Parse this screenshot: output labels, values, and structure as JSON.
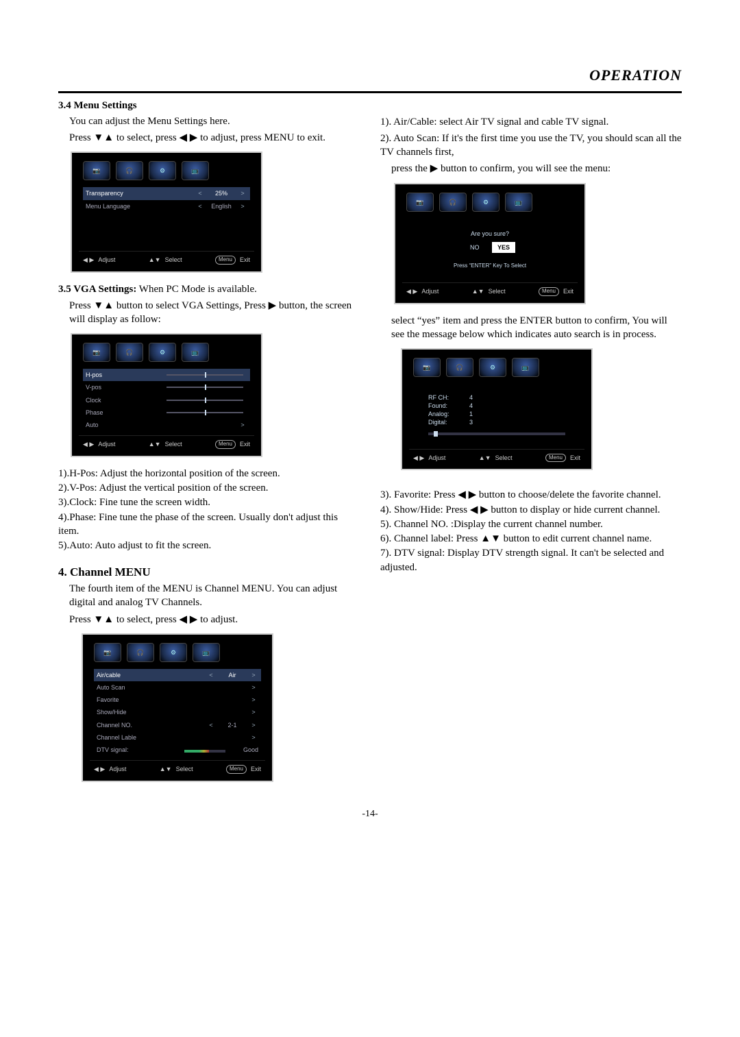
{
  "header": {
    "title": "OPERATION"
  },
  "footer": {
    "page": "-14-"
  },
  "left": {
    "s34": {
      "heading": "3.4  Menu Settings",
      "p1": "You can adjust the Menu Settings here.",
      "p2": "Press ▼▲ to select, press ◀ ▶ to adjust, press MENU to exit."
    },
    "s35": {
      "heading": "3.5  VGA Settings:",
      "heading_tail": " When PC Mode is  available.",
      "p1": "Press ▼▲ button to select VGA Settings, Press ▶ button, the screen will display as follow:",
      "i1": "1).H-Pos: Adjust the horizontal position of the screen.",
      "i2": "2).V-Pos: Adjust the vertical position of the screen.",
      "i3": "3).Clock: Fine tune the screen width.",
      "i4": "4).Phase: Fine tune the phase of the screen. Usually don't adjust this item.",
      "i5": "5).Auto: Auto adjust to fit the screen."
    },
    "s4": {
      "heading": "4. Channel MENU",
      "p1": "The fourth item of the MENU is Channel MENU. You can adjust digital and analog TV Channels.",
      "p2": "Press ▼▲   to select, press ◀ ▶   to adjust."
    }
  },
  "right": {
    "r1": "1). Air/Cable: select Air TV signal and cable TV signal.",
    "r2a": "2). Auto Scan: If it's the first time you use the TV, you should scan all the TV channels first,",
    "r2b": "press the ▶ button  to confirm, you will see the menu:",
    "r2cont": "select “yes” item and press the  ENTER  button  to confirm, You will see the message below which indicates auto search is in process.",
    "r3": "3). Favorite: Press ◀ ▶ button to choose/delete the favorite channel.",
    "r4": "4). Show/Hide: Press ◀ ▶ button to display or hide current channel.",
    "r5": "5). Channel NO. :Display the current channel number.",
    "r6": "6). Channel label: Press ▲▼ button to edit current channel name.",
    "r7": "7). DTV signal: Display DTV strength signal. It can't be selected and adjusted."
  },
  "osd_common": {
    "adjust": "Adjust",
    "select": "Select",
    "menu": "Menu",
    "exit": "Exit"
  },
  "osd_menu": {
    "row1_label": "Transparency",
    "row1_val": "25%",
    "row2_label": "Menu Language",
    "row2_val": "English"
  },
  "osd_vga": {
    "r1": "H-pos",
    "r2": "V-pos",
    "r3": "Clock",
    "r4": "Phase",
    "r5": "Auto"
  },
  "osd_channel": {
    "r1_label": "Air/cable",
    "r1_val": "Air",
    "r2_label": "Auto Scan",
    "r3_label": "Favorite",
    "r4_label": "Show/Hide",
    "r5_label": "Channel NO.",
    "r5_val": "2-1",
    "r6_label": "Channel Lable",
    "r7_label": "DTV signal:",
    "r7_val": "Good"
  },
  "osd_confirm": {
    "q": "Are you sure?",
    "no": "NO",
    "yes": "YES",
    "hint": "Press “ENTER” Key To Select"
  },
  "osd_scan": {
    "k1": "RF  CH:",
    "v1": "4",
    "k2": "Found:",
    "v2": "4",
    "k3": "Analog:",
    "v3": "1",
    "k4": "Digital:",
    "v4": "3"
  }
}
